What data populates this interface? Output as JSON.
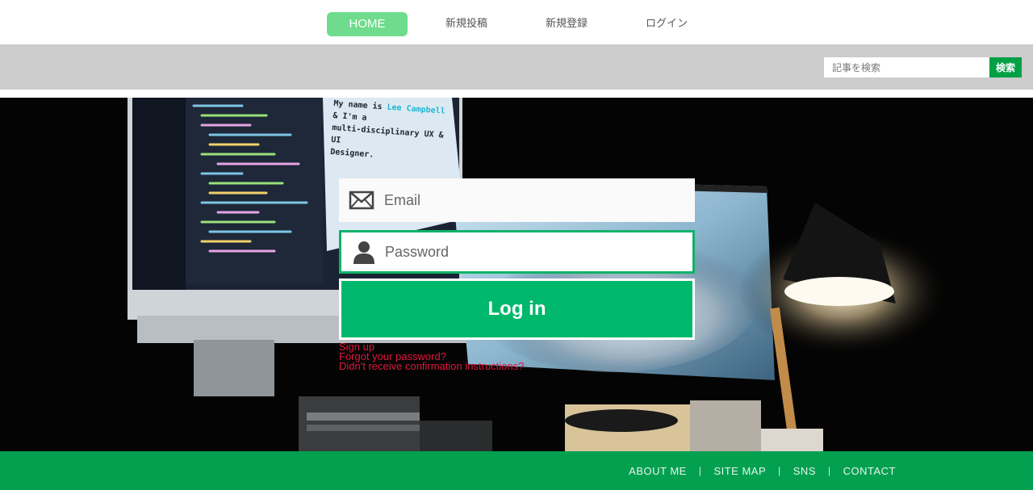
{
  "nav": {
    "items": [
      {
        "label": "HOME",
        "active": true
      },
      {
        "label": "新規投稿",
        "active": false
      },
      {
        "label": "新規登録",
        "active": false
      },
      {
        "label": "ログイン",
        "active": false
      }
    ]
  },
  "search": {
    "placeholder": "記事を検索",
    "button_label": "検索"
  },
  "hero": {
    "screen_text_line1_prefix": "My name is ",
    "screen_text_name": "Lee Campbell",
    "screen_text_line1_suffix": " & I'm a",
    "screen_text_line2": "multi-disciplinary UX & UI",
    "screen_text_line3": "Designer."
  },
  "login": {
    "email_placeholder": "Email",
    "password_placeholder": "Password",
    "submit_label": "Log in",
    "links": [
      "Sign up",
      "Forgot your password?",
      "Didn't receive confirmation instructions?"
    ]
  },
  "footer": {
    "links": [
      "ABOUT ME",
      "SITE MAP",
      "SNS",
      "CONTACT"
    ]
  },
  "colors": {
    "accent_green": "#00b86b",
    "nav_active": "#6edc8c",
    "footer_green": "#03a050",
    "link_red": "#e0183c"
  }
}
